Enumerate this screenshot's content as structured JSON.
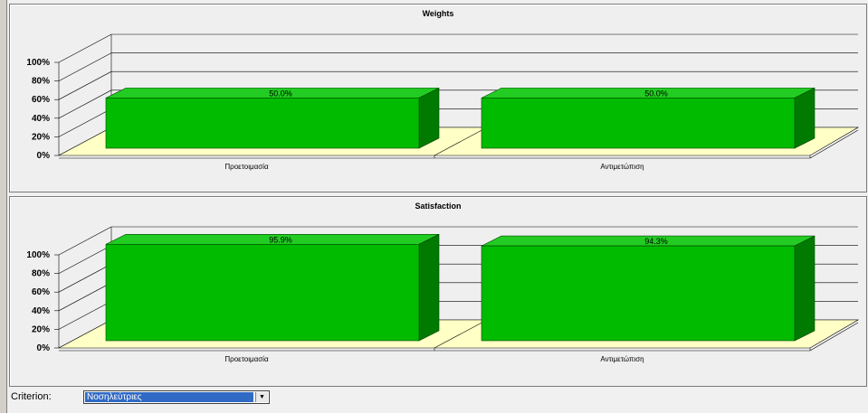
{
  "charts": [
    {
      "title": "Weights",
      "y_ticks": [
        "100%",
        "80%",
        "60%",
        "40%",
        "20%",
        "0%"
      ],
      "categories": [
        "Προετοιμασία",
        "Αντιμετώπιση"
      ],
      "values": [
        50.0,
        50.0
      ],
      "value_labels": [
        "50.0%",
        "50.0%"
      ]
    },
    {
      "title": "Satisfaction",
      "y_ticks": [
        "100%",
        "80%",
        "60%",
        "40%",
        "20%",
        "0%"
      ],
      "categories": [
        "Προετοιμασία",
        "Αντιμετώπιση"
      ],
      "values": [
        95.9,
        94.3
      ],
      "value_labels": [
        "95.9%",
        "94.3%"
      ]
    }
  ],
  "chart_data": [
    {
      "type": "bar",
      "title": "Weights",
      "categories": [
        "Προετοιμασία",
        "Αντιμετώπιση"
      ],
      "values": [
        50.0,
        50.0
      ],
      "ylim": [
        0,
        100
      ],
      "y_unit": "%",
      "grid": true,
      "bar_color": "#00bb00"
    },
    {
      "type": "bar",
      "title": "Satisfaction",
      "categories": [
        "Προετοιμασία",
        "Αντιμετώπιση"
      ],
      "values": [
        95.9,
        94.3
      ],
      "ylim": [
        0,
        100
      ],
      "y_unit": "%",
      "grid": true,
      "bar_color": "#00bb00"
    }
  ],
  "criterion": {
    "label": "Criterion:",
    "selected": "Νοσηλεύτριες"
  },
  "colors": {
    "bar_front": "#00bb00",
    "bar_top": "#22cc22",
    "bar_side": "#007a00",
    "floor": "#ffffc6"
  }
}
